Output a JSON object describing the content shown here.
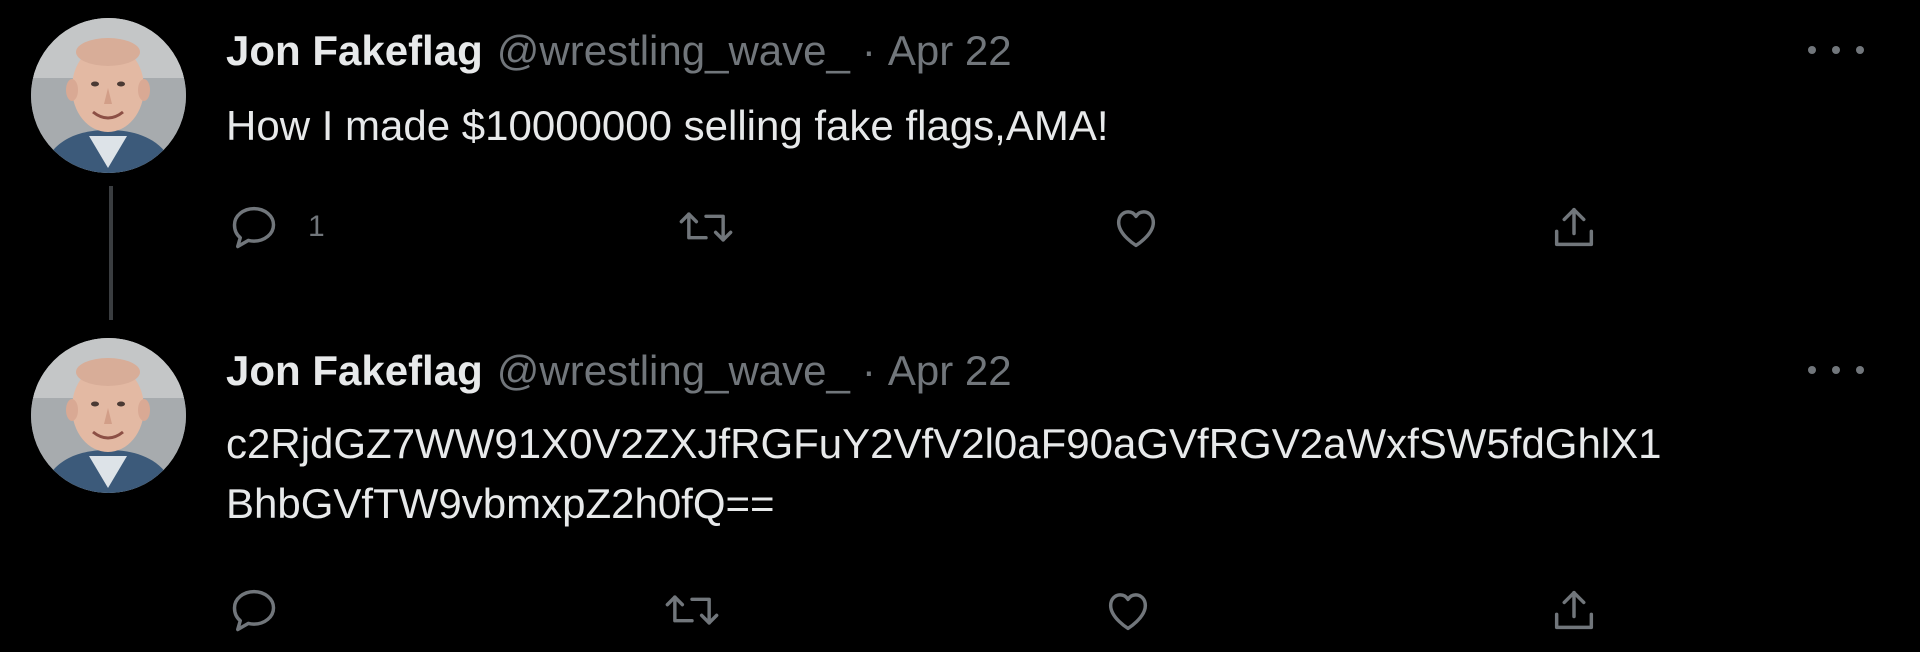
{
  "tweets": [
    {
      "author_name": "Jon Fakeflag",
      "handle": "@wrestling_wave_",
      "separator": "·",
      "date": "Apr 22",
      "text_lines": [
        "How I made $10000000 selling fake flags,AMA!"
      ],
      "actions": {
        "reply_count": "1",
        "reply_icon": "reply-icon",
        "retweet_icon": "retweet-icon",
        "like_icon": "heart-icon",
        "share_icon": "share-icon"
      }
    },
    {
      "author_name": "Jon Fakeflag",
      "handle": "@wrestling_wave_",
      "separator": "·",
      "date": "Apr 22",
      "text_lines": [
        "c2RjdGZ7WW91X0V2ZXJfRGFuY2VfV2l0aF90aGVfRGV2aWxfSW5fdGhlX1",
        "BhbGVfTW9vbmxpZ2h0fQ=="
      ],
      "actions": {
        "reply_count": "",
        "reply_icon": "reply-icon",
        "retweet_icon": "retweet-icon",
        "like_icon": "heart-icon",
        "share_icon": "share-icon"
      }
    }
  ],
  "colors": {
    "background": "#000000",
    "primary_text": "#e7e9ea",
    "secondary_text": "#71767b",
    "thread_line": "#3a3d40"
  }
}
